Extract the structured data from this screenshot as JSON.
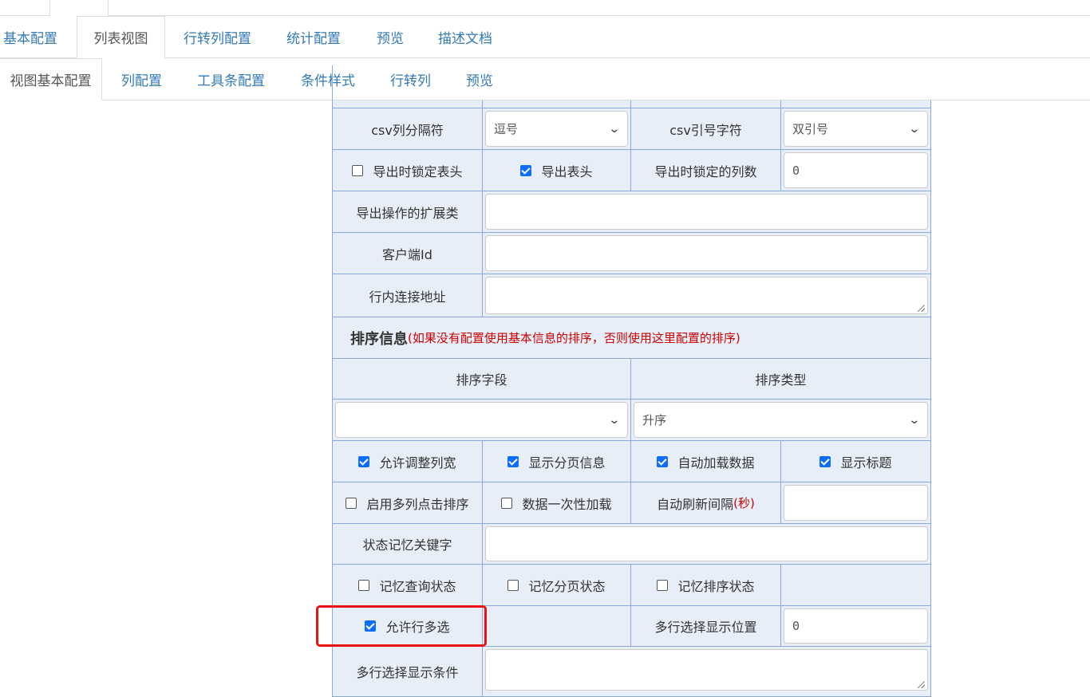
{
  "tabs_level2": [
    "基本配置",
    "列表视图",
    "行转列配置",
    "统计配置",
    "预览",
    "描述文档"
  ],
  "tabs_level3": [
    "视图基本配置",
    "列配置",
    "工具条配置",
    "条件样式",
    "行转列",
    "预览"
  ],
  "form": {
    "csv_sep_label": "csv列分隔符",
    "csv_sep_value": "逗号",
    "csv_quote_label": "csv引号字符",
    "csv_quote_value": "双引号",
    "lock_header_label": "导出时锁定表头",
    "export_header_label": "导出表头",
    "lock_cols_label": "导出时锁定的列数",
    "lock_cols_value": "0",
    "export_ext_label": "导出操作的扩展类",
    "client_id_label": "客户端Id",
    "inline_link_label": "行内连接地址",
    "sort_title": "排序信息",
    "sort_note": "(如果没有配置使用基本信息的排序，否则使用这里配置的排序)",
    "sort_field_header": "排序字段",
    "sort_type_header": "排序类型",
    "sort_type_value": "升序",
    "allow_resize_label": "允许调整列宽",
    "show_paging_label": "显示分页信息",
    "auto_load_label": "自动加载数据",
    "show_title_label": "显示标题",
    "multi_sort_label": "启用多列点击排序",
    "load_once_label": "数据一次性加载",
    "refresh_label": "自动刷新间隔",
    "refresh_unit": "(秒)",
    "state_key_label": "状态记忆关键字",
    "remember_query_label": "记忆查询状态",
    "remember_page_label": "记忆分页状态",
    "remember_sort_label": "记忆排序状态",
    "multi_select_label": "允许行多选",
    "multi_pos_label": "多行选择显示位置",
    "multi_pos_value": "0",
    "multi_cond_label": "多行选择显示条件"
  },
  "checkbox_states": {
    "lock_header": false,
    "export_header": true,
    "allow_resize": true,
    "show_paging": true,
    "auto_load": true,
    "show_title": true,
    "multi_sort": false,
    "load_once": false,
    "remember_query": false,
    "remember_page": false,
    "remember_sort": false,
    "multi_select": true
  },
  "colors": {
    "highlight": "#e8130f",
    "accent": "#0d6efd",
    "link": "#337ab7"
  }
}
